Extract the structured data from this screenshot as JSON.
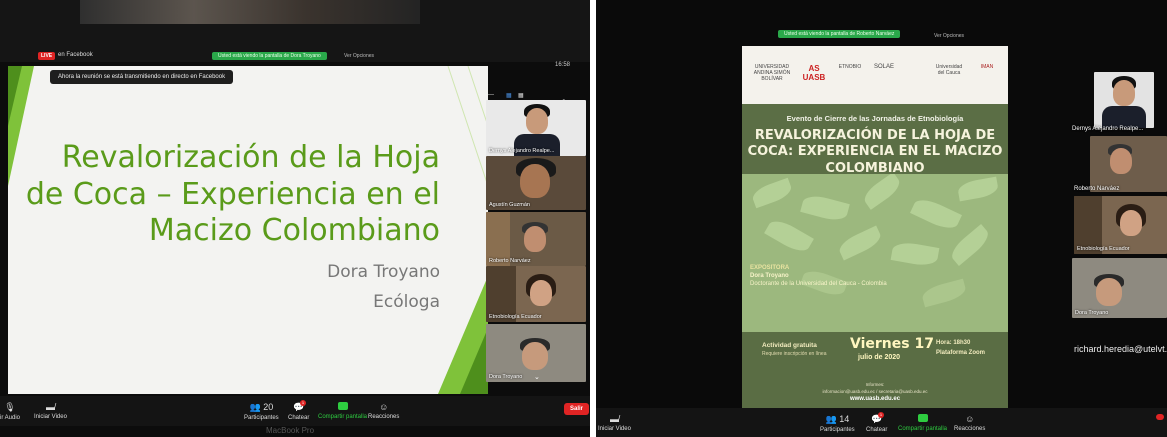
{
  "left": {
    "live_badge": "LIVE",
    "live_label": "en Facebook",
    "share_banner": "Usted está viendo la pantalla de Dora Troyano",
    "view_options": "Ver Opciones",
    "clock": "16:58",
    "fb_toast": "Ahora la reunión se está transmitiendo en directo en Facebook",
    "slide": {
      "title": "Revalorización de la Hoja de Coca – Experiencia en el Macizo Colombiano",
      "author": "Dora Troyano",
      "role": "Ecóloga"
    },
    "participants": [
      {
        "name": "Dernys Alejandro Realpe..."
      },
      {
        "name": "Agustín Guzmán"
      },
      {
        "name": "Roberto Narváez"
      },
      {
        "name": "Etnobiología Ecuador"
      },
      {
        "name": "Dora Troyano"
      }
    ],
    "toolbar": {
      "audio": "ir Audio",
      "video": "Iniciar Video",
      "participants_count": "20",
      "participants": "Participantes",
      "chat": "Chatear",
      "share": "Compartir pantalla",
      "reactions": "Reacciones",
      "leave": "Salir",
      "chat_badge": "1"
    },
    "laptop_label": "MacBook Pro"
  },
  "right": {
    "share_banner": "Usted está viendo la pantalla de Roberto Narváez",
    "view_options": "Ver Opciones",
    "poster": {
      "logos": [
        "UNIVERSIDAD ANDINA SIMÓN BOLÍVAR",
        "AS UASB",
        "ETNOBIO",
        "SOLAE",
        "",
        "Universidad del Cauca",
        "IMAN"
      ],
      "kicker": "Evento de Cierre de las Jornadas de Etnobiología",
      "title": "REVALORIZACIÓN DE LA HOJA DE COCA: EXPERIENCIA EN EL MACIZO COLOMBIANO",
      "speaker_label": "EXPOSITORA",
      "speaker_name": "Dora Troyano",
      "speaker_desc": "Doctorante de la Universidad del Cauca - Colombia",
      "free": "Actividad gratuita",
      "free_note": "Requiere inscripción en línea",
      "day": "Viernes 17",
      "month": "julio de 2020",
      "hour": "Hora: 18h30",
      "platform": "Plataforma Zoom",
      "info_label": "Informes:",
      "info": "informacion@uasb.edu.ec / secretaria@uasb.edu.ec",
      "url": "www.uasb.edu.ec"
    },
    "participants": [
      {
        "name": "Dernys Alejandro Realpe..."
      },
      {
        "name": "Roberto Narváez"
      },
      {
        "name": "Etnobiología Ecuador"
      },
      {
        "name": "Dora Troyano"
      }
    ],
    "large_name": "richard.heredia@utelvt...",
    "toolbar": {
      "video": "Iniciar Video",
      "participants_count": "14",
      "participants": "Participantes",
      "chat": "Chatear",
      "share": "Compartir pantalla",
      "reactions": "Reacciones",
      "chat_badge": "1"
    }
  },
  "colors": {
    "slide_green": "#5a9b1a",
    "zoom_green": "#2ecc40",
    "leave_red": "#e02424",
    "poster_green": "#5b6e45"
  }
}
